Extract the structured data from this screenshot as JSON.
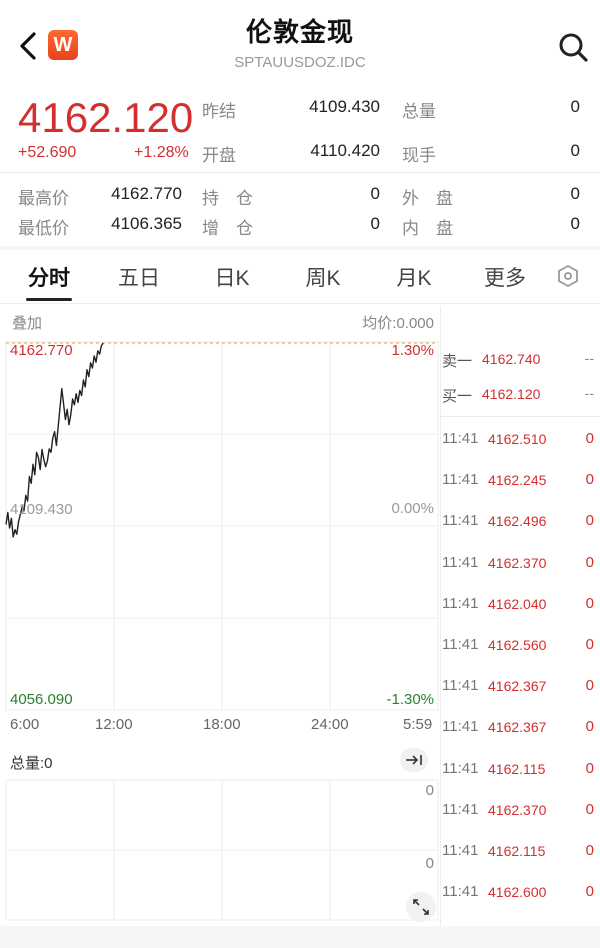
{
  "header": {
    "title": "伦敦金现",
    "subtitle": "SPTAUUSDOZ.IDC",
    "logo_text": "W",
    "icons": {
      "back": "chevron-left-icon",
      "search": "search-icon"
    }
  },
  "quote": {
    "price": "4162.120",
    "change": "+52.690",
    "change_pct": "+1.28%",
    "prev_close_label": "昨结",
    "prev_close": "4109.430",
    "open_label": "开盘",
    "open": "4110.420",
    "total_vol_label": "总量",
    "total_vol": "0",
    "cur_hand_label": "现手",
    "cur_hand": "0",
    "high_label": "最高价",
    "high": "4162.770",
    "low_label": "最低价",
    "low": "4106.365",
    "hold_label": "持　仓",
    "hold": "0",
    "add_label": "增　仓",
    "add": "0",
    "outer_label": "外　盘",
    "outer": "0",
    "inner_label": "内　盘",
    "inner": "0"
  },
  "tabs": [
    {
      "label": "分时",
      "active": true
    },
    {
      "label": "五日"
    },
    {
      "label": "日K"
    },
    {
      "label": "周K"
    },
    {
      "label": "月K"
    },
    {
      "label": "更多"
    }
  ],
  "chart": {
    "overlay_label": "叠加",
    "avg_label": "均价:0.000",
    "top_price": "4162.770",
    "top_pct": "1.30%",
    "mid_price": "4109.430",
    "mid_pct": "0.00%",
    "bottom_price": "4056.090",
    "bottom_pct": "-1.30%",
    "times": [
      "6:00",
      "12:00",
      "18:00",
      "24:00",
      "5:59"
    ],
    "volume_label": "总量:0",
    "vol_top": "0",
    "vol_mid": "0",
    "colors": {
      "up": "#d32f2f",
      "down": "#2e7d32",
      "line": "#222222"
    }
  },
  "chart_data": {
    "type": "line",
    "y_range": [
      4056.09,
      4162.77
    ],
    "x_range": [
      0,
      1440
    ],
    "x": [
      0,
      6,
      12,
      18,
      24,
      30,
      36,
      42,
      48,
      54,
      60,
      66,
      72,
      78,
      84,
      90,
      96,
      102,
      108,
      114,
      120,
      126,
      132,
      138,
      144,
      150,
      156,
      162,
      168,
      174,
      180,
      186,
      192,
      198,
      204,
      210,
      216,
      222,
      228,
      234,
      240,
      246,
      252,
      258,
      264,
      270,
      276,
      282,
      288,
      294,
      300,
      306,
      312,
      318,
      324
    ],
    "y": [
      4110.0,
      4113.5,
      4109.0,
      4111.8,
      4106.4,
      4108.5,
      4107.2,
      4110.9,
      4113.0,
      4115.2,
      4114.0,
      4118.5,
      4116.8,
      4124.0,
      4122.0,
      4127.5,
      4124.5,
      4131.0,
      4129.5,
      4126.0,
      4131.8,
      4129.0,
      4126.8,
      4128.5,
      4132.0,
      4131.0,
      4135.2,
      4137.0,
      4133.0,
      4138.5,
      4144.0,
      4149.5,
      4145.0,
      4140.5,
      4143.5,
      4139.0,
      4142.0,
      4146.5,
      4144.8,
      4148.0,
      4145.5,
      4149.0,
      4147.5,
      4152.0,
      4150.0,
      4155.0,
      4153.0,
      4157.0,
      4155.5,
      4159.0,
      4157.2,
      4160.5,
      4159.5,
      4162.0,
      4162.77
    ]
  },
  "book": {
    "sell_label": "卖一",
    "sell_price": "4162.740",
    "sell_vol": "--",
    "buy_label": "买一",
    "buy_price": "4162.120",
    "buy_vol": "--"
  },
  "trades": [
    {
      "time": "11:41",
      "price": "4162.510",
      "vol": "0"
    },
    {
      "time": "11:41",
      "price": "4162.245",
      "vol": "0"
    },
    {
      "time": "11:41",
      "price": "4162.496",
      "vol": "0"
    },
    {
      "time": "11:41",
      "price": "4162.370",
      "vol": "0"
    },
    {
      "time": "11:41",
      "price": "4162.040",
      "vol": "0"
    },
    {
      "time": "11:41",
      "price": "4162.560",
      "vol": "0"
    },
    {
      "time": "11:41",
      "price": "4162.367",
      "vol": "0"
    },
    {
      "time": "11:41",
      "price": "4162.367",
      "vol": "0"
    },
    {
      "time": "11:41",
      "price": "4162.115",
      "vol": "0"
    },
    {
      "time": "11:41",
      "price": "4162.370",
      "vol": "0"
    },
    {
      "time": "11:41",
      "price": "4162.115",
      "vol": "0"
    },
    {
      "time": "11:41",
      "price": "4162.600",
      "vol": "0"
    }
  ]
}
